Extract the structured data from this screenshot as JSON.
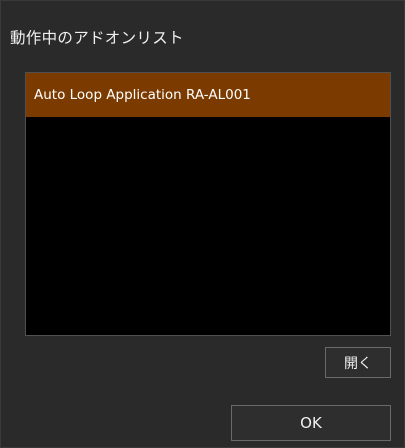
{
  "dialog": {
    "title": "動作中のアドオンリスト"
  },
  "addon_list": {
    "items": [
      {
        "label": "Auto Loop Application RA-AL001",
        "selected": true
      }
    ]
  },
  "buttons": {
    "open_label": "開く",
    "ok_label": "OK"
  },
  "colors": {
    "background": "#2a2a2a",
    "list_background": "#000000",
    "selected_item": "#7a3a00",
    "text": "#f0f0f0"
  }
}
